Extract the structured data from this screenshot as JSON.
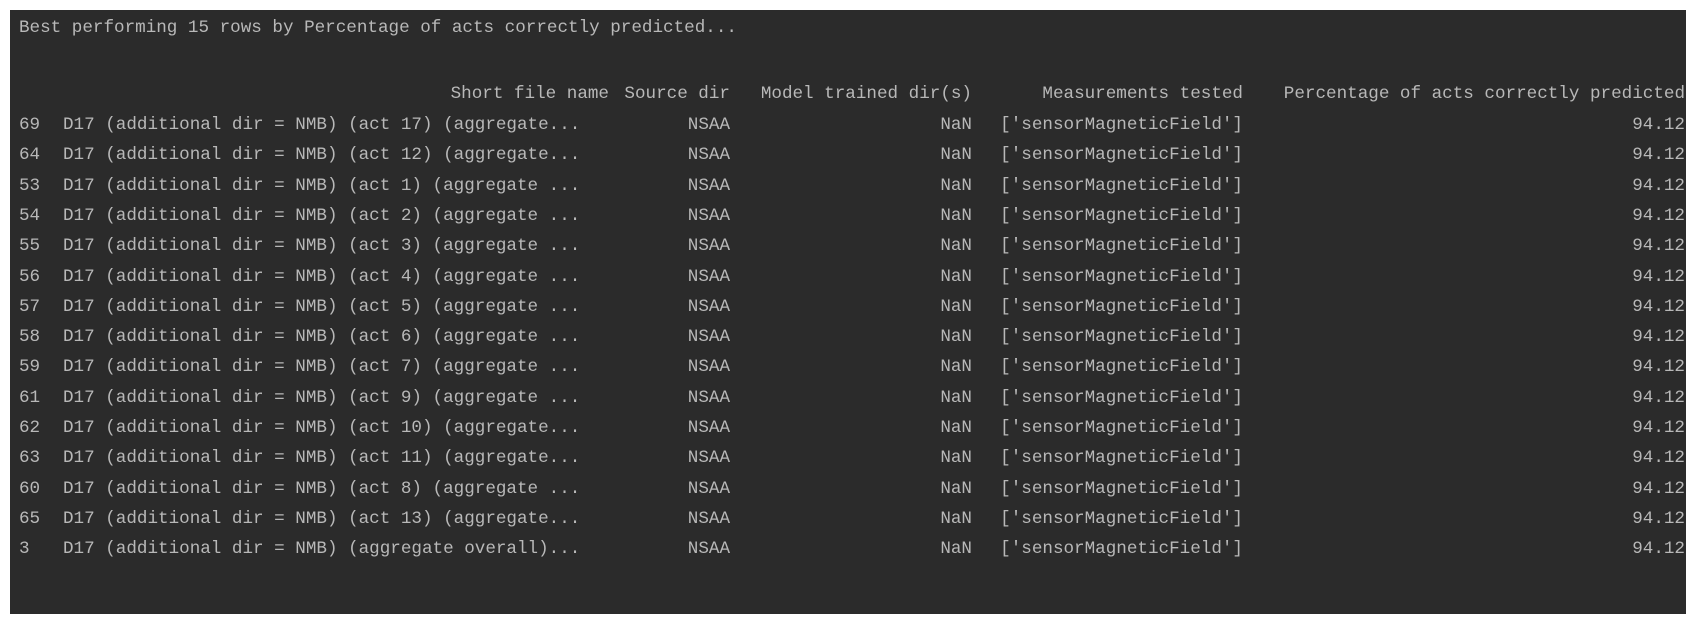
{
  "title": "Best performing 15 rows by Percentage of acts correctly predicted...",
  "columns": {
    "name": "Short file name",
    "source": "Source dir",
    "model": "Model trained dir(s)",
    "measurements": "Measurements tested",
    "percentage": "Percentage of acts correctly predicted"
  },
  "rows": [
    {
      "idx": "69",
      "name": "D17 (additional dir = NMB) (act 17) (aggregate...",
      "source": "NSAA",
      "model": "NaN",
      "measurements": "['sensorMagneticField']",
      "percentage": "94.12"
    },
    {
      "idx": "64",
      "name": "D17 (additional dir = NMB) (act 12) (aggregate...",
      "source": "NSAA",
      "model": "NaN",
      "measurements": "['sensorMagneticField']",
      "percentage": "94.12"
    },
    {
      "idx": "53",
      "name": "D17 (additional dir = NMB) (act 1) (aggregate ...",
      "source": "NSAA",
      "model": "NaN",
      "measurements": "['sensorMagneticField']",
      "percentage": "94.12"
    },
    {
      "idx": "54",
      "name": "D17 (additional dir = NMB) (act 2) (aggregate ...",
      "source": "NSAA",
      "model": "NaN",
      "measurements": "['sensorMagneticField']",
      "percentage": "94.12"
    },
    {
      "idx": "55",
      "name": "D17 (additional dir = NMB) (act 3) (aggregate ...",
      "source": "NSAA",
      "model": "NaN",
      "measurements": "['sensorMagneticField']",
      "percentage": "94.12"
    },
    {
      "idx": "56",
      "name": "D17 (additional dir = NMB) (act 4) (aggregate ...",
      "source": "NSAA",
      "model": "NaN",
      "measurements": "['sensorMagneticField']",
      "percentage": "94.12"
    },
    {
      "idx": "57",
      "name": "D17 (additional dir = NMB) (act 5) (aggregate ...",
      "source": "NSAA",
      "model": "NaN",
      "measurements": "['sensorMagneticField']",
      "percentage": "94.12"
    },
    {
      "idx": "58",
      "name": "D17 (additional dir = NMB) (act 6) (aggregate ...",
      "source": "NSAA",
      "model": "NaN",
      "measurements": "['sensorMagneticField']",
      "percentage": "94.12"
    },
    {
      "idx": "59",
      "name": "D17 (additional dir = NMB) (act 7) (aggregate ...",
      "source": "NSAA",
      "model": "NaN",
      "measurements": "['sensorMagneticField']",
      "percentage": "94.12"
    },
    {
      "idx": "61",
      "name": "D17 (additional dir = NMB) (act 9) (aggregate ...",
      "source": "NSAA",
      "model": "NaN",
      "measurements": "['sensorMagneticField']",
      "percentage": "94.12"
    },
    {
      "idx": "62",
      "name": "D17 (additional dir = NMB) (act 10) (aggregate...",
      "source": "NSAA",
      "model": "NaN",
      "measurements": "['sensorMagneticField']",
      "percentage": "94.12"
    },
    {
      "idx": "63",
      "name": "D17 (additional dir = NMB) (act 11) (aggregate...",
      "source": "NSAA",
      "model": "NaN",
      "measurements": "['sensorMagneticField']",
      "percentage": "94.12"
    },
    {
      "idx": "60",
      "name": "D17 (additional dir = NMB) (act 8) (aggregate ...",
      "source": "NSAA",
      "model": "NaN",
      "measurements": "['sensorMagneticField']",
      "percentage": "94.12"
    },
    {
      "idx": "65",
      "name": "D17 (additional dir = NMB) (act 13) (aggregate...",
      "source": "NSAA",
      "model": "NaN",
      "measurements": "['sensorMagneticField']",
      "percentage": "94.12"
    },
    {
      "idx": "3",
      "name": "D17 (additional dir = NMB) (aggregate overall)...",
      "source": "NSAA",
      "model": "NaN",
      "measurements": "['sensorMagneticField']",
      "percentage": "94.12"
    }
  ]
}
